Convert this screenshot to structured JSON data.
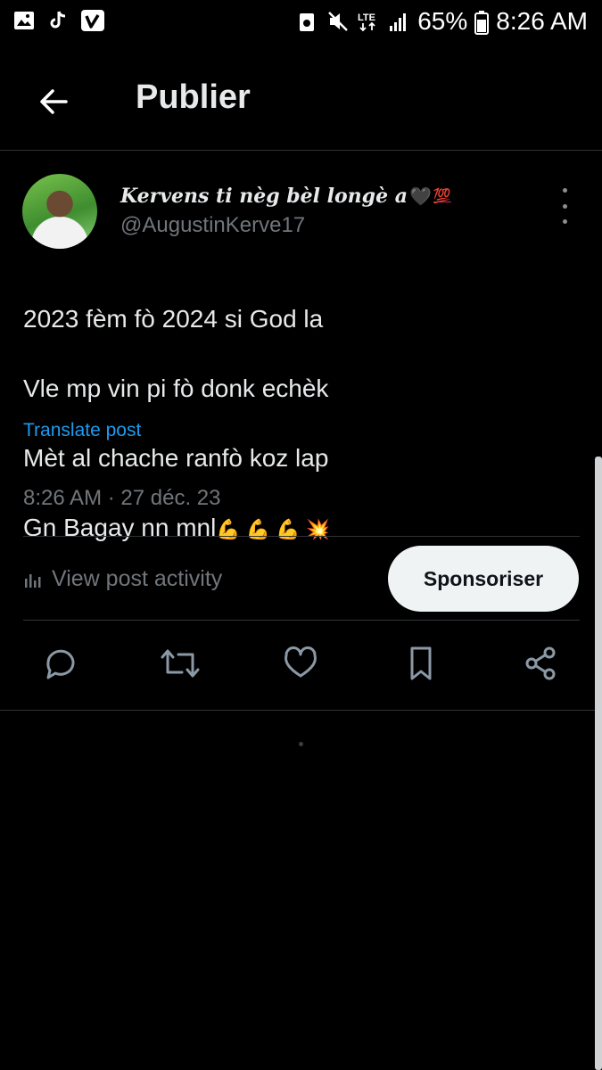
{
  "status_bar": {
    "battery": "65%",
    "time": "8:26 AM",
    "network": "LTE",
    "icons_left": [
      "gallery-icon",
      "tiktok-icon",
      "vimeo-icon"
    ],
    "icons_right": [
      "signal-mute-icon",
      "sound-off-icon",
      "lte-icon",
      "cell-signal-icon",
      "battery-icon"
    ]
  },
  "header": {
    "title": "Publier",
    "back_icon": "arrow-left-icon"
  },
  "post": {
    "display_name": "Kervens ti nèg bèl longè a",
    "name_emojis": [
      "🖤",
      "💯"
    ],
    "handle": "@AugustinKerve17",
    "lines": [
      "2023 fèm fò 2024 si God la",
      "Vle mp vin pi fò donk echèk",
      "Mèt al chache ranfò koz lap",
      "Gn Bagay nn mnl"
    ],
    "last_line_emojis": "💪 💪 💪 💥",
    "translate": "Translate post",
    "timestamp": "8:26 AM · 27 déc. 23",
    "view_activity": "View post activity",
    "sponsor": "Sponsoriser"
  },
  "actions": [
    "reply-icon",
    "retweet-icon",
    "like-icon",
    "bookmark-icon",
    "share-icon"
  ],
  "colors": {
    "background": "#000000",
    "text": "#e7e9ea",
    "muted": "#71767b",
    "link": "#1d9bf0",
    "divider": "#2f3336",
    "button_bg": "#eff3f4"
  }
}
